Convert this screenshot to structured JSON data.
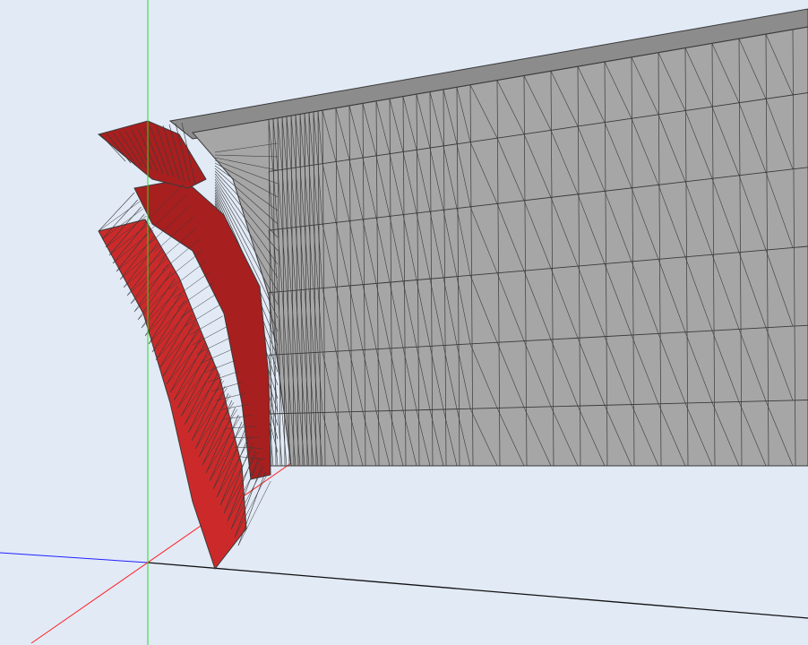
{
  "viewport": {
    "background_color": "#e2eaf6",
    "wireframe_color": "#3a3a3a"
  },
  "axes": {
    "x_axis_color": "#ff2020",
    "y_axis_color": "#22e022",
    "z_axis_color": "#2020ff",
    "ground_line_color": "#111111"
  },
  "meshes": [
    {
      "name": "grey-mesh-body",
      "face_color": "#a6a6a6",
      "top_face_color": "#8c8c8c"
    },
    {
      "name": "red-section-cut",
      "face_color": "#cc2a2a",
      "dark_face_color": "#a81f1f"
    }
  ]
}
